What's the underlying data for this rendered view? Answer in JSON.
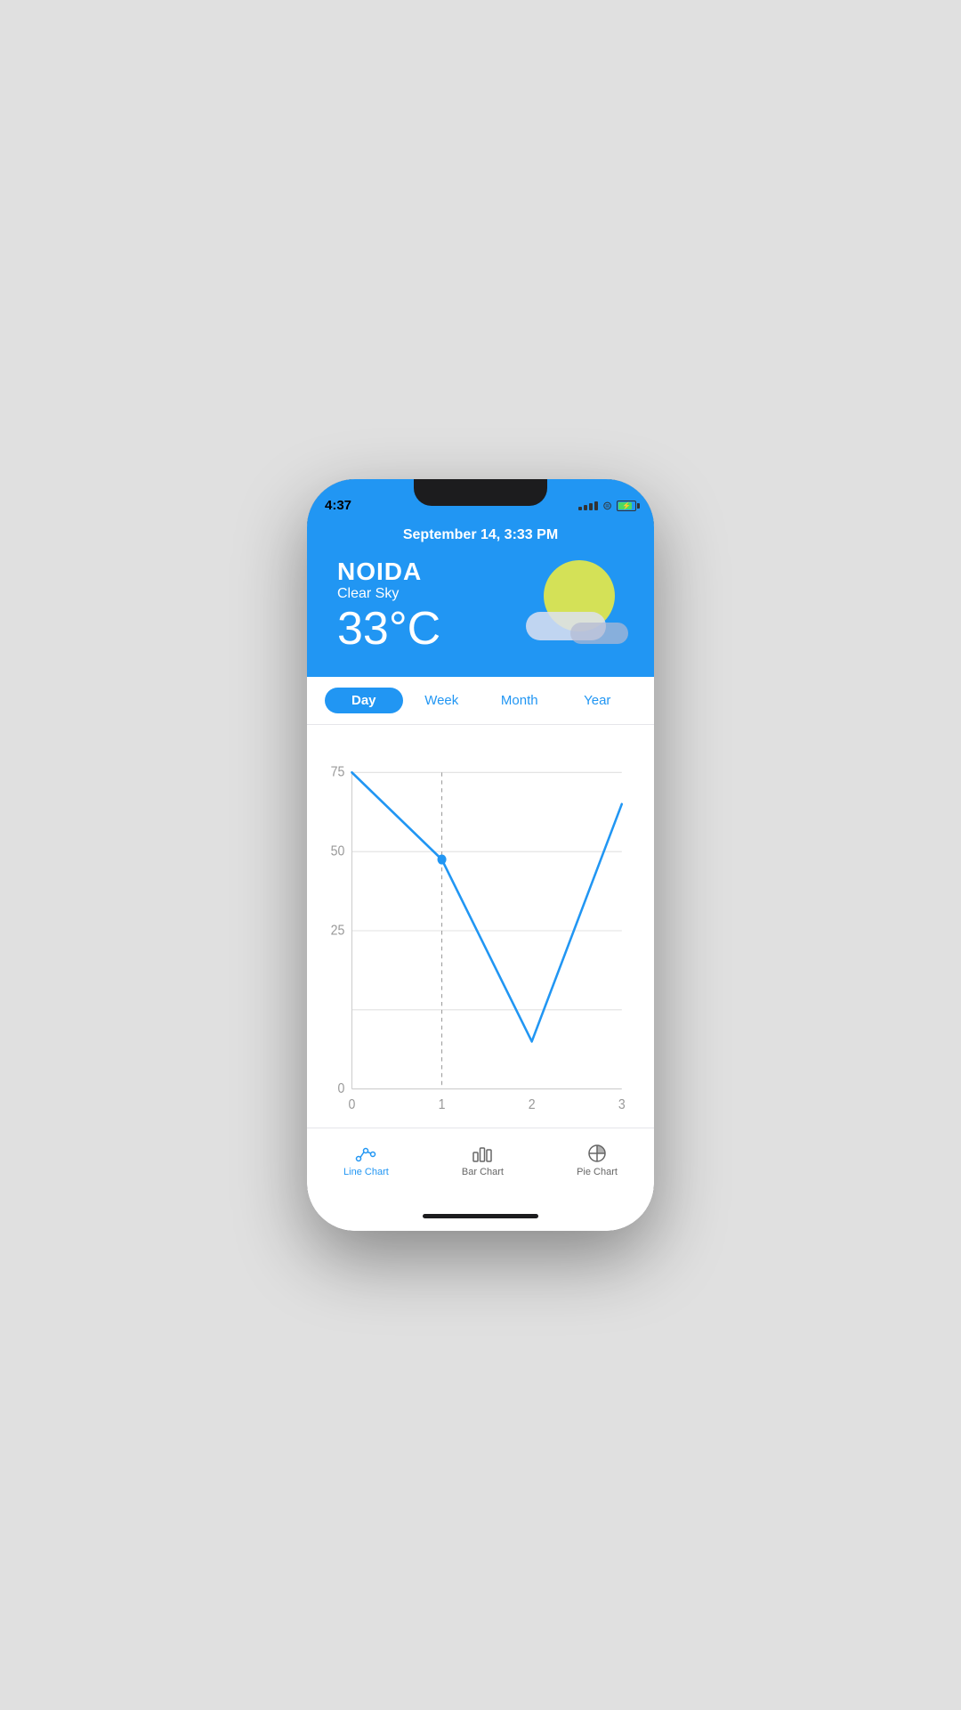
{
  "status_bar": {
    "time": "4:37"
  },
  "weather": {
    "date": "September 14, 3:33 PM",
    "city": "NOIDA",
    "condition": "Clear Sky",
    "temperature": "33°C"
  },
  "tabs": {
    "items": [
      {
        "label": "Day",
        "active": true
      },
      {
        "label": "Week",
        "active": false
      },
      {
        "label": "Month",
        "active": false
      },
      {
        "label": "Year",
        "active": false
      }
    ]
  },
  "chart": {
    "y_labels": [
      "75",
      "50",
      "25",
      "0"
    ],
    "x_labels": [
      "0",
      "1",
      "2",
      "3"
    ]
  },
  "bottom_nav": {
    "items": [
      {
        "label": "Line Chart",
        "active": true
      },
      {
        "label": "Bar Chart",
        "active": false
      },
      {
        "label": "Pie Chart",
        "active": false
      }
    ]
  }
}
